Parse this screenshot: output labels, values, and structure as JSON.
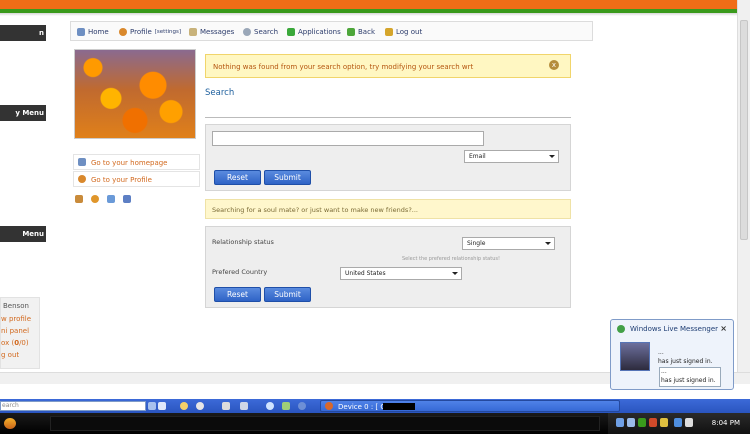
{
  "nav": {
    "home": "Home",
    "profile": "Profile",
    "profile_settings": "[settings]",
    "messages": "Messages",
    "search": "Search",
    "applications": "Applications",
    "back": "Back",
    "logout": "Log out"
  },
  "sidebar": {
    "headers": [
      "n",
      "y Menu",
      "Menu"
    ],
    "user_name": "Benson",
    "links": [
      "w profile",
      "ni panel",
      "ox",
      "g out"
    ],
    "inbox_count_new": "0",
    "inbox_count_total": "0"
  },
  "left_links": {
    "homepage": "Go to your homepage",
    "profile": "Go to your Profile"
  },
  "alert": {
    "text": "Nothing was found from your search option, try modifying your search wrt",
    "close_icon": "close-icon"
  },
  "search": {
    "title": "Search",
    "query_value": "",
    "field_option": "Email",
    "reset_label": "Reset",
    "submit_label": "Submit"
  },
  "note": {
    "text": "Searching for a soul mate? or just want to make new friends?..."
  },
  "advanced": {
    "relationship_label": "Relationship status",
    "relationship_value": "Single",
    "relationship_hint": "Select the prefered relationship status!",
    "country_label": "Prefered Country",
    "country_value": "United States",
    "reset_label": "Reset",
    "submit_label": "Submit"
  },
  "messenger": {
    "title": "Windows Live Messenger",
    "dots1": "...",
    "line1": "has just signed in.",
    "dots2": "...",
    "line2": "has just signed in."
  },
  "taskbar": {
    "search_placeholder": "earch",
    "device_label": "Device 0 : [ G: ]",
    "clock": "8:04 PM"
  },
  "colors": {
    "accent_orange": "#f06d17",
    "accent_green": "#3a9a1c",
    "link_orange": "#d2691e",
    "button_blue": "#2f63c6"
  }
}
